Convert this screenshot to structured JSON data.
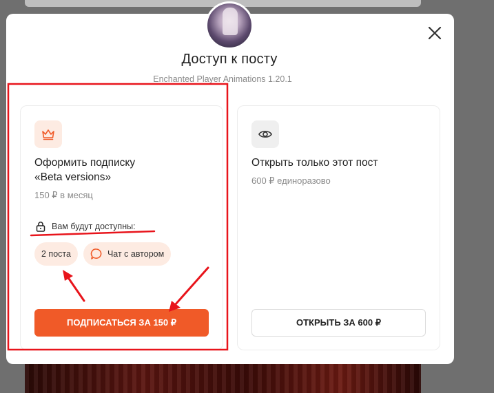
{
  "modal": {
    "title": "Доступ к посту",
    "subtitle": "Enchanted Player Animations 1.20.1"
  },
  "subscription": {
    "title_line1": "Оформить подписку",
    "title_line2": "«Beta versions»",
    "price": "150 ₽ в месяц",
    "access_label": "Вам будут доступны:",
    "chips": [
      "2 поста",
      "Чат с автором"
    ],
    "button_label": "ПОДПИСАТЬСЯ ЗА 150 ₽",
    "icon": "crown-icon"
  },
  "single_post": {
    "title": "Открыть только этот пост",
    "price": "600 ₽ единоразово",
    "button_label": "ОТКРЫТЬ ЗА 600 ₽",
    "icon": "eye-icon"
  },
  "colors": {
    "accent": "#f05a28",
    "accent_light": "#fdebe2",
    "annotation_red": "#e8141b"
  }
}
